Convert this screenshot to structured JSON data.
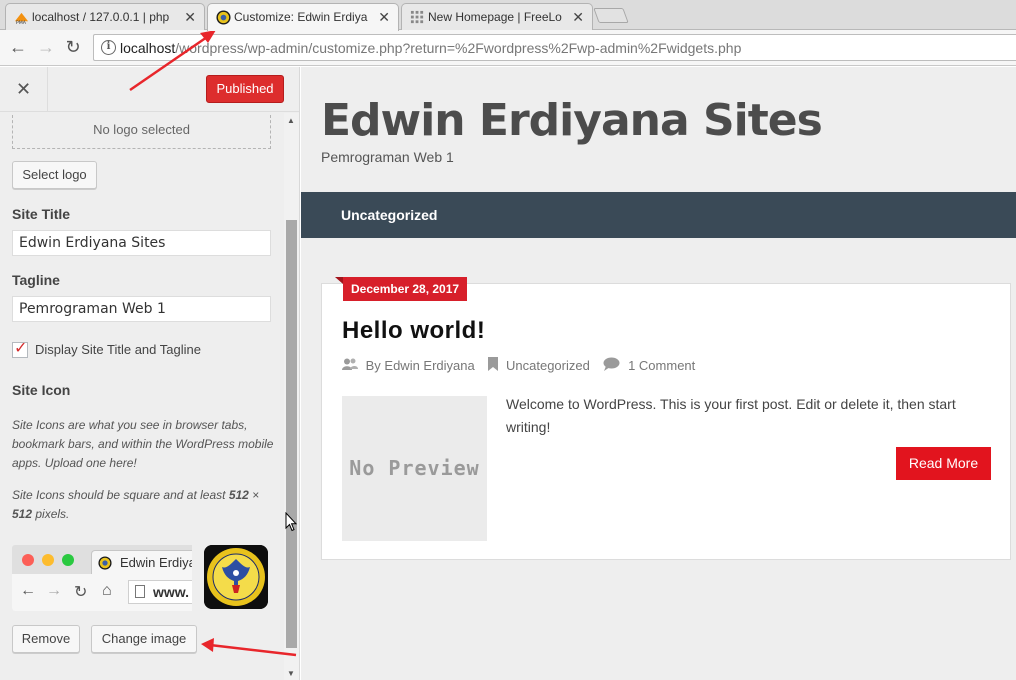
{
  "browser": {
    "tabs": [
      {
        "label": "localhost / 127.0.0.1 | php",
        "icon": "phpmyadmin-favicon"
      },
      {
        "label": "Customize: Edwin Erdiyana",
        "icon": "site-emblem-favicon"
      },
      {
        "label": "New Homepage | FreeLogo",
        "icon": "grid-favicon"
      }
    ],
    "url_host": "localhost",
    "url_path": "/wordpress/wp-admin/customize.php?return=%2Fwordpress%2Fwp-admin%2Fwidgets.php"
  },
  "customizer": {
    "publish_label": "Published",
    "logo_placeholder": "No logo selected",
    "select_logo_label": "Select logo",
    "site_title_label": "Site Title",
    "site_title_value": "Edwin Erdiyana Sites",
    "tagline_label": "Tagline",
    "tagline_value": "Pemrograman Web 1",
    "display_title_label": "Display Site Title and Tagline",
    "site_icon_label": "Site Icon",
    "site_icon_desc1": "Site Icons are what you see in browser tabs, bookmark bars, and within the WordPress mobile apps. Upload one here!",
    "site_icon_desc2_pre": "Site Icons should be square and at least ",
    "site_icon_desc2_size1": "512",
    "site_icon_desc2_x": " × ",
    "site_icon_desc2_size2": "512",
    "site_icon_desc2_post": " pixels.",
    "preview_tab_label": "Edwin Erdiyana",
    "preview_url": "www.",
    "remove_label": "Remove",
    "change_image_label": "Change image"
  },
  "site": {
    "title": "Edwin Erdiyana Sites",
    "tagline": "Pemrograman Web 1",
    "menu_item": "Uncategorized",
    "post": {
      "date": "December 28, 2017",
      "title": "Hello world!",
      "author": "By Edwin Erdiyana",
      "category": "Uncategorized",
      "comments": "1 Comment",
      "thumbnail_text": "No Preview",
      "excerpt": "Welcome to WordPress. This is your first post. Edit or delete it, then start writing!",
      "read_more": "Read More"
    }
  },
  "colors": {
    "accent_red": "#dd2d2d",
    "nav_bar": "#3a4a57",
    "annotation_arrow": "#e8262b"
  }
}
